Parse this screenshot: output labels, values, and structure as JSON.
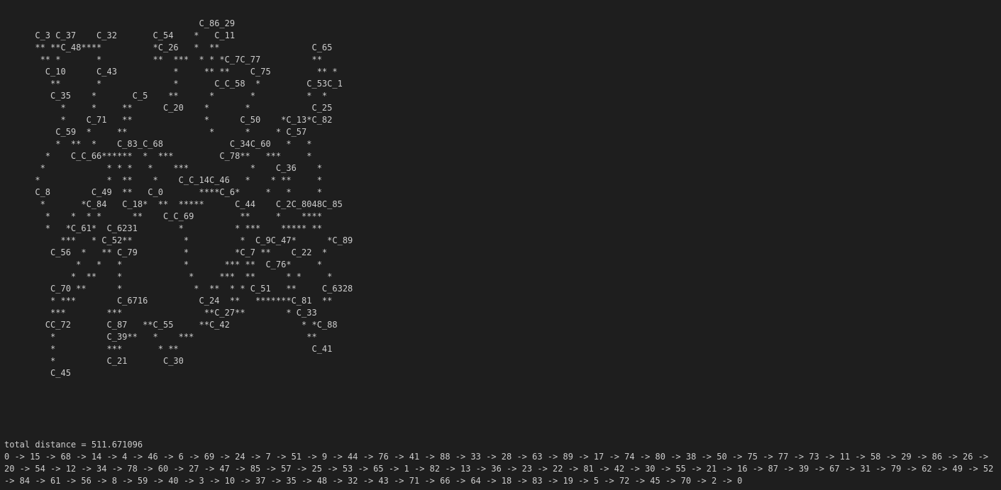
{
  "terminal": {
    "ascii_plot": "                                      C_86_29\n      C_3 C_37    C_32       C_54    *   C_11\n      ** **C_48****          *C_26   *  **                  C_65\n       ** *       *          **  ***  * * *C_7C_77          **\n        C_10      C_43           *     ** **    C_75         ** *\n         **       *              *       C_C_58  *         C_53C_1\n         C_35    *       C_5    **      *       *          *  *\n           *     *     **      C_20    *       *            C_25\n           *    C_71   **              *      C_50    *C_13*C_82\n          C_59  *     **                *      *     * C_57\n          *  **  *    C_83_C_68             C_34C_60   *   *\n        *    C_C_66******  *  ***         C_78**   ***     *\n       *            * * *   *    ***            *    C_36    *\n      *             *  **    *    C_C_14C_46   *    * **     *\n      C_8        C_49  **   C_0       ****C_6*     *   *     *\n       *       *C_84   C_18*  **  *****      C_44    C_2C_8048C_85\n        *    *  * *      **    C_C_69         **     *    ****\n        *   *C_61*  C_6231        *          * ***    ***** **\n           ***   * C_52**          *          *  C_9C_47*      *C_89\n         C_56  *   ** C_79         *         *C_7 **    C_22  *\n              *   *   *            *       *** **  C_76*     *\n             *  **    *             *     ***  **      * *     *\n         C_70 **      *              *  **  * * C_51   **     C_6328\n         * ***        C_6716          C_24  **   *******C_81  **\n         ***        ***                **C_27**        * C_33\n        CC_72       C_87   **C_55     **C_42              * *C_88\n         *          C_39**   *    ***                      **\n         *          ***       * **                          C_41\n         *          C_21       C_30\n         C_45",
    "total_distance_line": "total distance = 511.671096",
    "route_line": "0 -> 15 -> 68 -> 14 -> 4 -> 46 -> 6 -> 69 -> 24 -> 7 -> 51 -> 9 -> 44 -> 76 -> 41 -> 88 -> 33 -> 28 -> 63 -> 89 -> 17 -> 74 -> 80 -> 38 -> 50 -> 75 -> 77 -> 73 -> 11 -> 58 -> 29 -> 86 -> 26 -> 20 -> 54 -> 12 -> 34 -> 78 -> 60 -> 27 -> 47 -> 85 -> 57 -> 25 -> 53 -> 65 -> 1 -> 82 -> 13 -> 36 -> 23 -> 22 -> 81 -> 42 -> 30 -> 55 -> 21 -> 16 -> 87 -> 39 -> 67 -> 31 -> 79 -> 62 -> 49 -> 52 -> 84 -> 61 -> 56 -> 8 -> 59 -> 40 -> 3 -> 10 -> 37 -> 35 -> 48 -> 32 -> 43 -> 71 -> 66 -> 64 -> 18 -> 83 -> 19 -> 5 -> 72 -> 45 -> 70 -> 2 -> 0",
    "colors": {
      "background": "#1e1e1e",
      "text": "#cccccc",
      "link": "#3794ff"
    }
  }
}
